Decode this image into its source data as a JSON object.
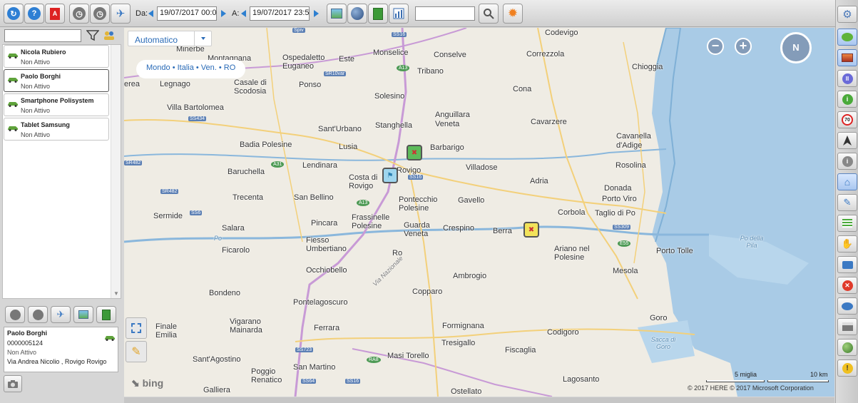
{
  "toolbar": {
    "from_label": "Da:",
    "from_value": "19/07/2017 00:00",
    "to_label": "A:",
    "to_value": "19/07/2017 23:59",
    "search_value": "",
    "icons": [
      "refresh-icon",
      "help-icon",
      "pdf-icon",
      "clock-icon",
      "clock-icon",
      "route-icon",
      "map-image-icon",
      "globe-icon",
      "sheet-icon",
      "bar-chart-icon",
      "search-icon",
      "sun-icon",
      "settings-icon"
    ]
  },
  "devices": [
    {
      "name": "Nicola Rubiero",
      "status": "Non Attivo"
    },
    {
      "name": "Paolo Borghi",
      "status": "Non Attivo"
    },
    {
      "name": "Smartphone Polisystem",
      "status": "Non Attivo"
    },
    {
      "name": "Tablet Samsung",
      "status": "Non Attivo"
    }
  ],
  "selected_device": {
    "name": "Paolo Borghi",
    "id": "0000005124",
    "status": "Non Attivo",
    "address": "Via Andrea Nicolio ,  Rovigo Rovigo"
  },
  "map": {
    "mode": "Automatico",
    "breadcrumb": "Mondo • Italia • Ven. • RO",
    "compass": "N",
    "zoom_out": "−",
    "zoom_in": "+",
    "scale_miles": "5 miglia",
    "scale_km": "10 km",
    "copyright": "© 2017 HERE   © 2017 Microsoft Corporation",
    "provider": "bing",
    "places": [
      {
        "name": "Codevigo"
      },
      {
        "name": "Monselice"
      },
      {
        "name": "Conselve"
      },
      {
        "name": "Correzzola"
      },
      {
        "name": "Chioggia"
      },
      {
        "name": "Minerbe"
      },
      {
        "name": "Montagnana"
      },
      {
        "name": "Ospedaletto Euganeo"
      },
      {
        "name": "Este"
      },
      {
        "name": "Tribano"
      },
      {
        "name": "Legnago"
      },
      {
        "name": "Casale di Scodosia"
      },
      {
        "name": "Ponso"
      },
      {
        "name": "Cona"
      },
      {
        "name": "Solesino"
      },
      {
        "name": "Villa Bartolomea"
      },
      {
        "name": "Anguillara Veneta"
      },
      {
        "name": "Stanghella"
      },
      {
        "name": "Cavarzere"
      },
      {
        "name": "Sant'Urbano"
      },
      {
        "name": "Cavanella d'Adige"
      },
      {
        "name": "Badia Polesine"
      },
      {
        "name": "Lusia"
      },
      {
        "name": "Barbarigo"
      },
      {
        "name": "Lendinara"
      },
      {
        "name": "Rosolina"
      },
      {
        "name": "Baruchella"
      },
      {
        "name": "Costa di Rovigo"
      },
      {
        "name": "Rovigo"
      },
      {
        "name": "Villadose"
      },
      {
        "name": "Adria"
      },
      {
        "name": "Donada"
      },
      {
        "name": "Trecenta"
      },
      {
        "name": "San Bellino"
      },
      {
        "name": "Pontecchio Polesine"
      },
      {
        "name": "Gavello"
      },
      {
        "name": "Porto Viro"
      },
      {
        "name": "Sermide"
      },
      {
        "name": "Corbola"
      },
      {
        "name": "Taglio di Po"
      },
      {
        "name": "Salara"
      },
      {
        "name": "Pincara"
      },
      {
        "name": "Frassinelle Polesine"
      },
      {
        "name": "Guarda Veneta"
      },
      {
        "name": "Crespino"
      },
      {
        "name": "Berra"
      },
      {
        "name": "Ficarolo"
      },
      {
        "name": "Fiesso Umbertiano"
      },
      {
        "name": "Ro"
      },
      {
        "name": "Ariano nel Polesine"
      },
      {
        "name": "Porto Tolle"
      },
      {
        "name": "Occhiobello"
      },
      {
        "name": "Ambrogio"
      },
      {
        "name": "Mesola"
      },
      {
        "name": "Bondeno"
      },
      {
        "name": "Copparo"
      },
      {
        "name": "Pontelagoscuro"
      },
      {
        "name": "Goro"
      },
      {
        "name": "Finale Emilia"
      },
      {
        "name": "Vigarano Mainarda"
      },
      {
        "name": "Ferrara"
      },
      {
        "name": "Formignana"
      },
      {
        "name": "Codigoro"
      },
      {
        "name": "Tresigallo"
      },
      {
        "name": "Fiscaglia"
      },
      {
        "name": "Sant'Agostino"
      },
      {
        "name": "Masi Torello"
      },
      {
        "name": "Poggio Renatico"
      },
      {
        "name": "San Martino"
      },
      {
        "name": "Lagosanto"
      },
      {
        "name": "Galliera"
      },
      {
        "name": "Ostellato"
      },
      {
        "name": "erea"
      }
    ],
    "water_labels": [
      "Po",
      "Po della Pila",
      "Sacca di Goro",
      "Via Nazionale"
    ],
    "road_signs": [
      "Spiv",
      "SS16",
      "A13",
      "SR10var",
      "SS434",
      "A31",
      "SR482",
      "SS16",
      "A13",
      "SR482",
      "SS6",
      "SS309",
      "E55",
      "SS723",
      "RA8",
      "SS64",
      "SS16"
    ]
  },
  "left_panel": {
    "search_value": "",
    "filter_icon": "filter-icon",
    "group_icon": "group-icon"
  },
  "right_bar_icons": [
    "settings-icon",
    "chat-icon",
    "photo-icon",
    "pause-icon",
    "info-green-icon",
    "speed-limit-icon",
    "navigation-arrow-icon",
    "info-gray-icon",
    "home-icon",
    "pen-icon",
    "list-icon",
    "hand-icon",
    "camera-icon",
    "close-red-icon",
    "comment-icon",
    "print-icon",
    "globe-green-icon",
    "warning-icon"
  ]
}
